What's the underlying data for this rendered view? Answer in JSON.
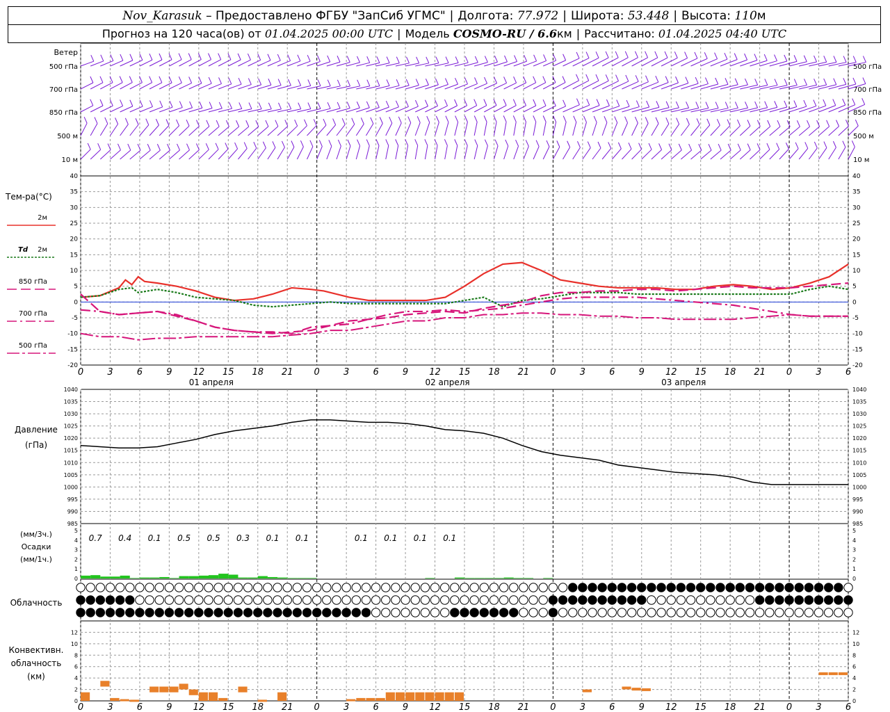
{
  "header": {
    "station": "Nov_Karasuk",
    "provider": "– Предоставлено ФГБУ \"ЗапСиб УГМС\"",
    "lon_label": "Долгота:",
    "lon_value": "77.972",
    "lat_label": "Широта:",
    "lat_value": "53.448",
    "alt_label": "Высота:",
    "alt_value": "110",
    "alt_unit": "м",
    "forecast_label": "Прогноз на 120 часа(ов) от",
    "forecast_start": "01.04.2025 00:00 UTC",
    "model_label": "Модель",
    "model_name": "COSMO-RU / 6.6",
    "model_unit": "км",
    "computed_label": "Рассчитано:",
    "computed_time": "01.04.2025 04:40 UTC"
  },
  "labels": {
    "wind": "Ветер",
    "wind_levels": [
      "500 гПа",
      "700 гПа",
      "850 гПа",
      "500  м",
      "10  м"
    ],
    "temp_title": "Тем-ра(°C)",
    "legend_2m": "2м",
    "legend_td": "Td",
    "legend_td_2m": "2м",
    "legend_850": "850 гПа",
    "legend_700": "700 гПа",
    "legend_500": "500 гПа",
    "pressure_title": "Давление",
    "pressure_unit": "(гПа)",
    "precip_top": "(мм/3ч.)",
    "precip_mid": "Осадки",
    "precip_bot": "(мм/1ч.)",
    "cloud": "Облачность",
    "conv1": "Конвективн.",
    "conv2": "облачность",
    "conv3": "(км)",
    "days": [
      "01 апреля",
      "02 апреля",
      "03 апреля"
    ]
  },
  "colors": {
    "temp2m": "#e8302a",
    "td2m": "#1a7a1a",
    "t850": "#d6157a",
    "t700": "#d6157a",
    "t500": "#d6157a",
    "wind": "#7a1ad6",
    "precip": "#22c41e",
    "conv": "#e8802a",
    "zero": "#1a3ad6"
  },
  "chart_data": [
    {
      "type": "line",
      "name": "temperature",
      "x_hours": [
        0,
        6,
        12,
        18,
        24,
        30,
        36,
        42,
        48,
        54,
        60,
        66,
        72,
        78,
        84,
        90,
        96,
        102,
        108,
        114,
        120
      ],
      "xtick_labels": [
        "0",
        "3",
        "6",
        "9",
        "12",
        "15",
        "18",
        "21",
        "0",
        "3",
        "6",
        "9",
        "12",
        "15",
        "18",
        "21",
        "0",
        "3",
        "6",
        "9",
        "12",
        "15",
        "18",
        "21",
        "0",
        "3",
        "6"
      ],
      "ylim": [
        -20,
        40
      ],
      "yticks": [
        -20,
        -15,
        -10,
        -5,
        0,
        5,
        10,
        15,
        20,
        25,
        30,
        35,
        40
      ],
      "series": [
        {
          "name": "2м",
          "x": [
            0,
            3,
            6,
            7,
            8,
            9,
            10,
            12,
            15,
            18,
            21,
            24,
            27,
            30,
            33,
            36,
            38,
            42,
            45,
            48,
            51,
            54,
            57,
            60,
            63,
            66,
            69,
            72,
            75,
            78,
            81,
            84,
            87,
            90,
            93,
            96,
            99,
            102,
            105,
            108,
            111,
            114,
            117,
            120
          ],
          "values": [
            1.5,
            2,
            4.5,
            7,
            5.5,
            8,
            6.5,
            6,
            5,
            3.5,
            1.5,
            0.5,
            1,
            2.5,
            4.5,
            4,
            3.5,
            1.5,
            0.5,
            0.5,
            0.5,
            0.5,
            1.5,
            5,
            9,
            12,
            12.5,
            10,
            7,
            6,
            5,
            4.5,
            4.5,
            4.5,
            4,
            4,
            5,
            5.5,
            5,
            4,
            4.5,
            6,
            8,
            12
          ]
        },
        {
          "name": "Td 2м",
          "x": [
            0,
            3,
            6,
            8,
            9,
            12,
            15,
            18,
            21,
            24,
            27,
            30,
            33,
            36,
            39,
            42,
            45,
            48,
            51,
            54,
            57,
            60,
            63,
            66,
            69,
            72,
            75,
            78,
            81,
            84,
            87,
            90,
            93,
            96,
            99,
            102,
            105,
            108,
            111,
            114,
            117,
            120
          ],
          "values": [
            1.5,
            2,
            4,
            4.5,
            3,
            4,
            3,
            1.5,
            1,
            0.5,
            -1,
            -1.5,
            -1,
            -0.5,
            0,
            -0.5,
            -0.5,
            -0.5,
            -0.5,
            -0.5,
            -0.5,
            0.5,
            1.5,
            -1.5,
            0.5,
            1,
            2,
            3,
            3,
            3,
            2.5,
            2.5,
            2.5,
            2.5,
            2.5,
            2.5,
            2.5,
            2.5,
            2.5,
            4,
            5,
            4
          ]
        },
        {
          "name": "850 гПа",
          "x": [
            0,
            3,
            6,
            9,
            12,
            15,
            18,
            21,
            24,
            27,
            30,
            33,
            36,
            39,
            42,
            45,
            48,
            51,
            54,
            57,
            60,
            63,
            66,
            69,
            72,
            75,
            78,
            81,
            84,
            87,
            90,
            93,
            96,
            99,
            102,
            105,
            108,
            111,
            114,
            117,
            120
          ],
          "values": [
            2.5,
            -3,
            -4,
            -3.5,
            -3,
            -4.5,
            -6,
            -8,
            -9,
            -9.5,
            -10,
            -9.5,
            -9,
            -7.5,
            -6,
            -5.5,
            -5,
            -4,
            -3.5,
            -3,
            -3.5,
            -2,
            -1,
            0,
            2,
            3,
            3,
            3.5,
            3.5,
            4,
            4,
            3.5,
            4,
            4.5,
            5,
            4.5,
            4.5,
            4.5,
            5,
            5.5,
            6
          ]
        },
        {
          "name": "700 гПа",
          "x": [
            0,
            3,
            6,
            9,
            12,
            15,
            18,
            21,
            24,
            27,
            30,
            33,
            36,
            39,
            42,
            45,
            48,
            51,
            54,
            57,
            60,
            63,
            66,
            69,
            72,
            75,
            78,
            81,
            84,
            87,
            90,
            93,
            96,
            99,
            102,
            105,
            108,
            111,
            114,
            117,
            120
          ],
          "values": [
            -2.5,
            -3,
            -4,
            -3.5,
            -3,
            -4,
            -6,
            -8,
            -9,
            -9.5,
            -9.5,
            -10,
            -8,
            -7.5,
            -7,
            -5.5,
            -4,
            -3,
            -3,
            -2.5,
            -3,
            -2.5,
            -2,
            -1,
            0,
            1,
            1.5,
            1.5,
            1.5,
            1.5,
            1,
            0.5,
            0,
            -0.5,
            -1,
            -2,
            -3,
            -4,
            -4.5,
            -4.5,
            -4.5
          ]
        },
        {
          "name": "500 гПа",
          "x": [
            0,
            3,
            6,
            9,
            12,
            15,
            18,
            21,
            24,
            27,
            30,
            33,
            36,
            39,
            42,
            45,
            48,
            51,
            54,
            57,
            60,
            63,
            66,
            69,
            72,
            75,
            78,
            81,
            84,
            87,
            90,
            93,
            96,
            99,
            102,
            105,
            108,
            111,
            114,
            117,
            120
          ],
          "values": [
            -10,
            -11,
            -11,
            -12,
            -11.5,
            -11.5,
            -11,
            -11,
            -11,
            -11,
            -11,
            -10.5,
            -10,
            -9,
            -9,
            -8,
            -7,
            -6,
            -6,
            -5,
            -5,
            -4,
            -4,
            -3.5,
            -3.5,
            -4,
            -4,
            -4.5,
            -4.5,
            -5,
            -5,
            -5.5,
            -5.5,
            -5.5,
            -5.5,
            -5,
            -4.5,
            -4,
            -4.5,
            -4.5,
            -4.5
          ]
        }
      ]
    },
    {
      "type": "line",
      "name": "pressure",
      "ylim": [
        985,
        1040
      ],
      "yticks": [
        985,
        990,
        995,
        1000,
        1005,
        1010,
        1015,
        1020,
        1025,
        1030,
        1035,
        1040
      ],
      "x": [
        0,
        3,
        6,
        9,
        12,
        15,
        18,
        21,
        24,
        27,
        30,
        33,
        36,
        39,
        42,
        45,
        48,
        51,
        54,
        57,
        60,
        63,
        66,
        69,
        72,
        75,
        78,
        81,
        84,
        87,
        90,
        93,
        96,
        99,
        102,
        105,
        108,
        111,
        114,
        117,
        120
      ],
      "values": [
        1017,
        1016.5,
        1016,
        1016,
        1016.5,
        1018,
        1019.5,
        1021.5,
        1023,
        1024,
        1025,
        1026.5,
        1027.5,
        1027.5,
        1027,
        1026.5,
        1026.5,
        1026,
        1025,
        1023.5,
        1023,
        1022,
        1020,
        1017,
        1014.5,
        1013,
        1012,
        1011,
        1009,
        1008,
        1007,
        1006,
        1005.5,
        1005,
        1004,
        1002,
        1001,
        1001,
        1001,
        1001,
        1001
      ]
    },
    {
      "type": "bar",
      "name": "precipitation",
      "ylim": [
        0,
        5
      ],
      "yticks": [
        0,
        1,
        2,
        3,
        4,
        5
      ],
      "labels_3h": [
        "0.7",
        "0.4",
        "0.1",
        "0.5",
        "0.5",
        "0.3",
        "0.1",
        "0.1",
        "",
        "0.1",
        "0.1",
        "0.1",
        "0.1"
      ],
      "x": [
        0,
        1,
        2,
        3,
        4,
        5,
        6,
        7,
        8,
        9,
        10,
        11,
        12,
        13,
        14,
        15,
        16,
        17,
        18,
        19,
        20,
        21,
        22,
        23,
        24,
        25,
        26,
        27,
        28,
        29,
        30,
        31,
        32,
        33,
        34,
        35,
        36,
        37,
        38,
        39,
        40,
        41,
        42,
        43,
        44,
        45,
        46,
        47
      ],
      "values": [
        0.3,
        0.35,
        0.2,
        0.2,
        0.3,
        0.05,
        0.1,
        0.1,
        0.15,
        0.05,
        0.25,
        0.25,
        0.3,
        0.35,
        0.5,
        0.4,
        0.1,
        0.1,
        0.25,
        0.15,
        0.1,
        0.05,
        0.05,
        0.05,
        0,
        0,
        0,
        0,
        0,
        0,
        0,
        0,
        0,
        0,
        0,
        0.05,
        0,
        0,
        0.1,
        0.05,
        0.05,
        0.05,
        0.05,
        0.1,
        0.05,
        0.05,
        0,
        0.05
      ]
    },
    {
      "type": "bar",
      "name": "convective_cloud",
      "ylim": [
        0,
        14
      ],
      "yticks": [
        0,
        2,
        4,
        6,
        8,
        10,
        12
      ],
      "x": [
        0,
        2,
        3,
        4,
        5,
        6,
        7,
        8,
        9,
        10,
        11,
        12,
        13,
        14,
        15,
        16,
        17,
        18,
        19,
        20,
        21,
        22,
        23,
        24,
        25,
        26,
        27,
        28,
        29,
        30,
        31,
        32,
        33,
        34,
        35,
        36,
        37,
        38,
        39,
        40,
        41,
        42,
        43,
        44,
        45,
        46,
        47
      ],
      "values": [
        1.5,
        3.5,
        0.5,
        0.3,
        0.2,
        0,
        2.5,
        2.5,
        2.5,
        3,
        2,
        1.5,
        1.5,
        0.5,
        0,
        2.5,
        0,
        0.2,
        0,
        1.5,
        0,
        0,
        0,
        0,
        0,
        0,
        0.3,
        0.5,
        0.5,
        0.5,
        1.5,
        1.5,
        1.5,
        1.5,
        1.5,
        1.5,
        1.5,
        1.5,
        0,
        0,
        0,
        0,
        0,
        0,
        0,
        0,
        0
      ]
    }
  ]
}
